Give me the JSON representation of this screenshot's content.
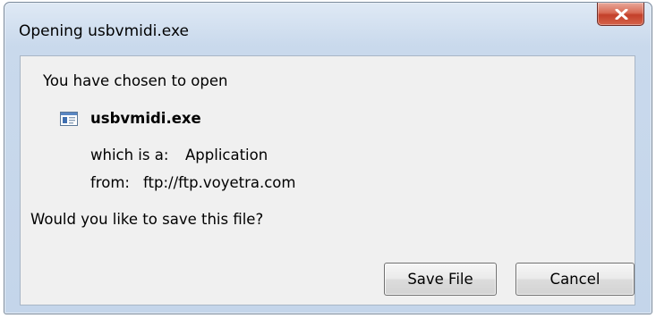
{
  "window": {
    "title": "Opening usbvmidi.exe",
    "close_icon": "close-x-icon"
  },
  "dialog": {
    "intro": "You have chosen to open",
    "file_icon": "application-file-icon",
    "filename": "usbvmidi.exe",
    "type_label": "which is a:",
    "type_value": "Application",
    "from_label": "from:",
    "from_value": "ftp://ftp.voyetra.com",
    "question": "Would you like to save this file?"
  },
  "buttons": {
    "save": "Save File",
    "cancel": "Cancel"
  },
  "colors": {
    "frame": "#c4d5ea",
    "close_button": "#c3402a",
    "client_bg": "#f0f0f0"
  }
}
